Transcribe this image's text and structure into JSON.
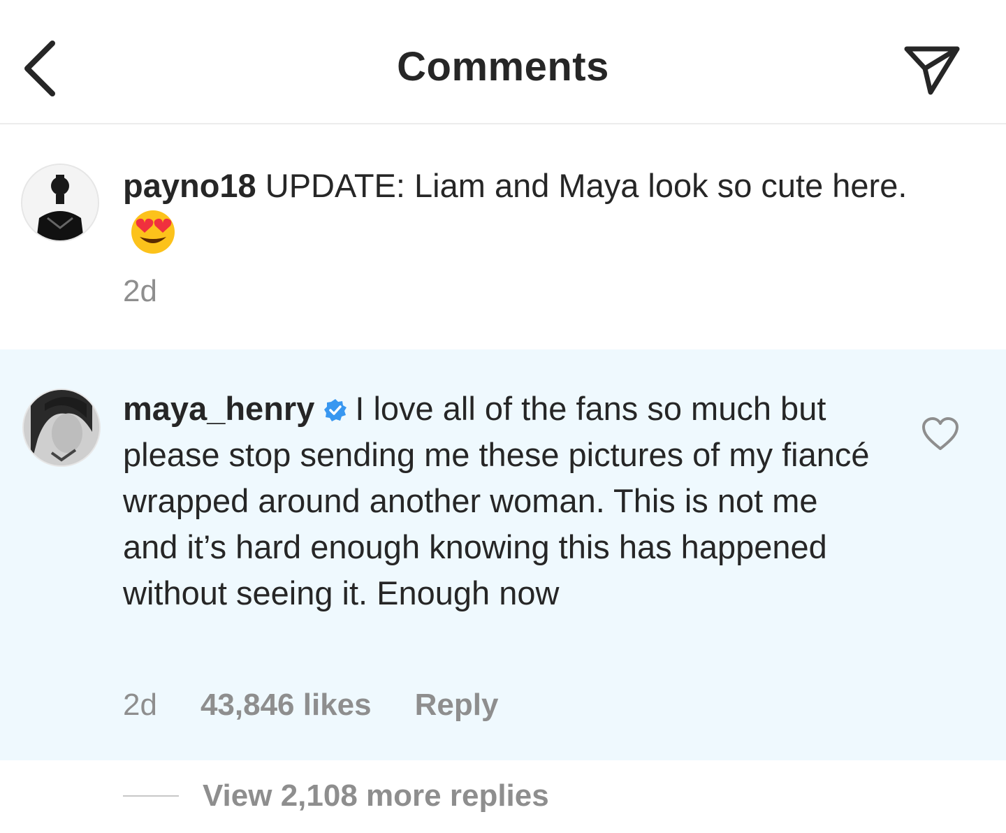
{
  "header": {
    "title": "Comments",
    "back_icon": "chevron-left-icon",
    "share_icon": "paper-plane-icon"
  },
  "caption": {
    "username": "payno18",
    "text": "UPDATE: Liam and Maya look so cute here.",
    "emoji": "heart-eyes-emoji",
    "time": "2d"
  },
  "comment": {
    "username": "maya_henry",
    "verified": true,
    "text": "I love all of the fans so much but please stop sending me these pictures of my fiancé wrapped around another woman. This is not me and it’s hard enough knowing this has happened without seeing it. Enough now",
    "time": "2d",
    "likes": "43,846 likes",
    "reply_label": "Reply",
    "like_icon": "heart-outline-icon",
    "highlight_color": "#eff9fe"
  },
  "view_replies": {
    "label": "View 2,108 more replies"
  },
  "colors": {
    "text": "#262626",
    "secondary": "#8e8e8e",
    "verified": "#3897f0"
  }
}
